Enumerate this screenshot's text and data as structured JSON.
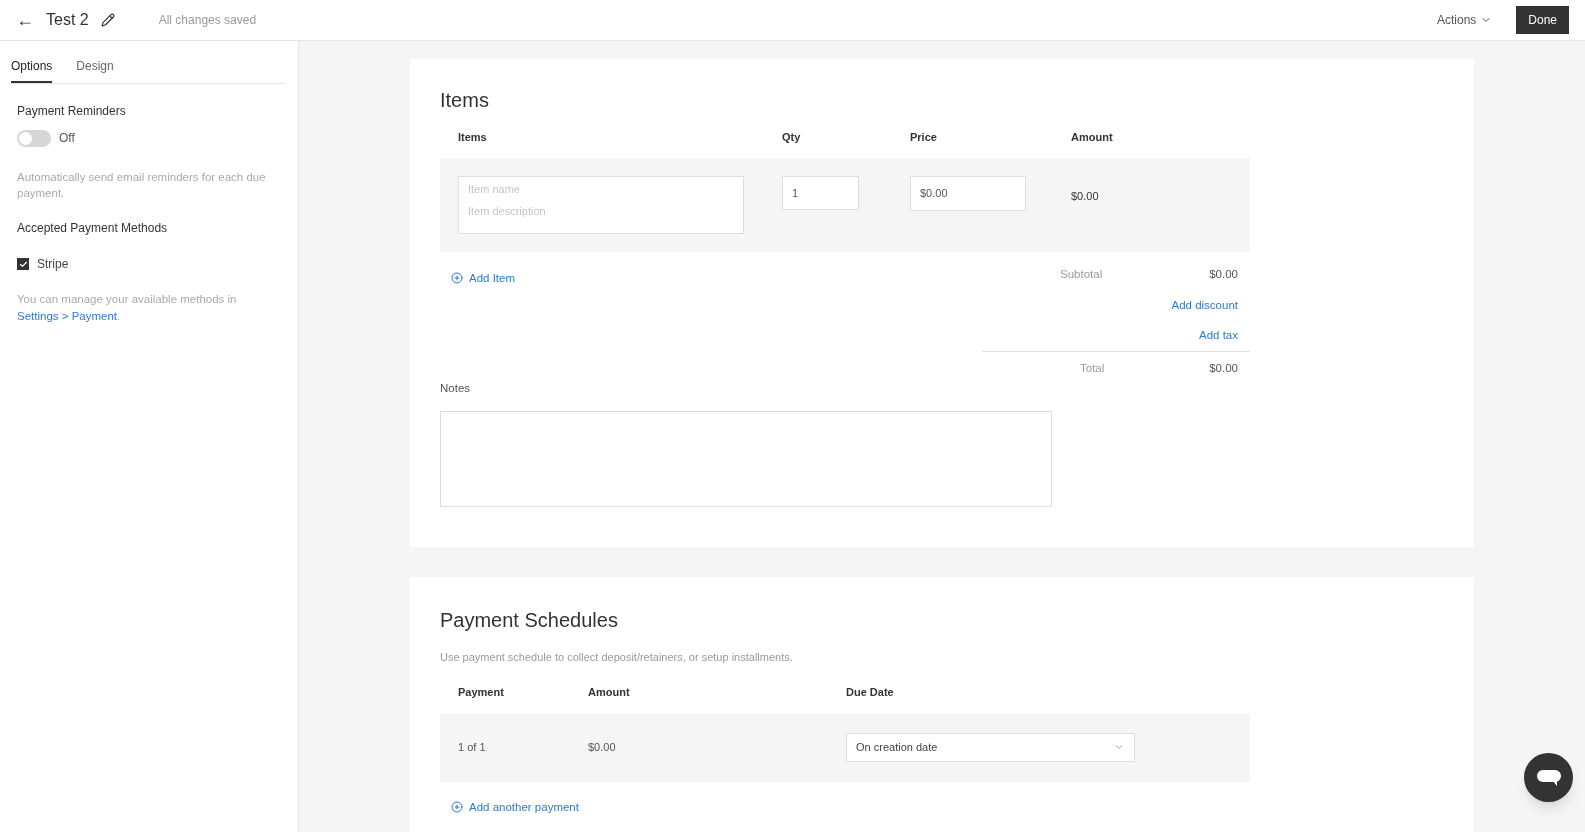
{
  "header": {
    "back": "←",
    "title": "Test 2",
    "status": "All changes saved",
    "actions": "Actions",
    "done": "Done"
  },
  "sidebar": {
    "tabs": [
      {
        "label": "Options",
        "selected": true
      },
      {
        "label": "Design",
        "selected": false
      }
    ],
    "reminders": {
      "title": "Payment Reminders",
      "on": false,
      "state_label": "Off",
      "hint": "Automatically send email reminders for each due payment."
    },
    "methods": {
      "title": "Accepted Payment Methods",
      "items": [
        {
          "label": "Stripe",
          "checked": true
        }
      ],
      "hint": "You can manage your available methods in",
      "link": "Settings > Payment",
      "after": "."
    }
  },
  "items": {
    "title": "Items",
    "columns": [
      "Items",
      "Qty",
      "Price",
      "Amount"
    ],
    "rows": [
      {
        "name_placeholder": "Item name",
        "description_placeholder": "Item description",
        "qty": "1",
        "price": "$0.00",
        "amount": "$0.00"
      }
    ],
    "add_item": "Add Item",
    "subtotal_label": "Subtotal",
    "subtotal": "$0.00",
    "add_discount": "Add discount",
    "add_tax": "Add tax",
    "total_label": "Total",
    "total": "$0.00",
    "notes_label": "Notes"
  },
  "schedules": {
    "title": "Payment Schedules",
    "hint": "Use payment schedule to collect deposit/retainers, or setup installments.",
    "columns": [
      "Payment",
      "Amount",
      "Due Date"
    ],
    "rows": [
      {
        "payment": "1 of 1",
        "amount": "$0.00",
        "due": "On creation date"
      }
    ],
    "add": "Add another payment"
  }
}
